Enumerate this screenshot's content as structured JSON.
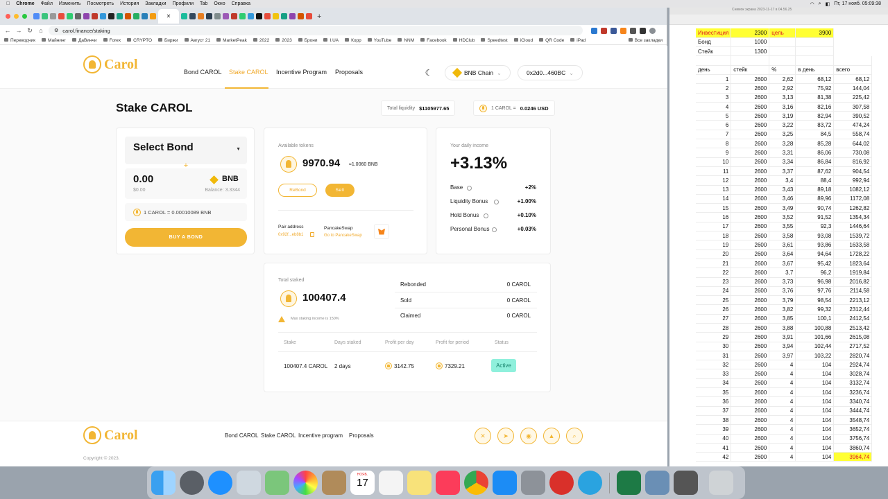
{
  "mac_menu": {
    "apple": "",
    "app": "Chrome",
    "items": [
      "Файл",
      "Изменить",
      "Посмотреть",
      "История",
      "Закладки",
      "Профили",
      "Tab",
      "Окно",
      "Справка"
    ],
    "clock": "Пт, 17 нояб. 05:09:38"
  },
  "browser": {
    "active_tab_icon": "✕",
    "url": "carol.finance/staking",
    "bookmarks": [
      "Переводчик",
      "Майнинг",
      "ДаВинчи",
      "Forex",
      "CRYPTO",
      "Биржи",
      "Август 21",
      "MarketPeak",
      "2022",
      "2023",
      "Брони",
      "I.UA",
      "Корр",
      "YouTube",
      "NNM",
      "Facebook",
      "HDClub",
      "Speedtest",
      "iCloud",
      "QR Code",
      "iPad",
      "Все закладки"
    ]
  },
  "site": {
    "logo": "Carol",
    "nav": [
      "Bond CAROL",
      "Stake CAROL",
      "Incentive Program",
      "Proposals"
    ],
    "chain": "BNB Chain",
    "wallet": "0x2d0...460BC",
    "page_title": "Stake CAROL",
    "total_liquidity_label": "Total liquidity",
    "total_liquidity": "$1105977.65",
    "price_label": "1 CAROL =",
    "price": "0.0246 USD",
    "bond": {
      "select": "Select Bond",
      "plus": "+",
      "amount": "0.00",
      "usd": "$0.00",
      "token": "BNB",
      "balance": "Balance: 3.3344",
      "rate": "1 CAROL = 0.00010089 BNB",
      "buy": "BUY A BOND"
    },
    "available": {
      "label": "Available tokens",
      "amount": "9970.94",
      "bnb": "≈1.0060 BNB",
      "rebond": "ReBond",
      "sell": "Sell",
      "pair_label": "Pair address",
      "pair_value": "0x92f...eb8b1",
      "pancake_label": "PancakeSwap",
      "pancake_link": "Go to PancakeSwap"
    },
    "income": {
      "label": "Your daily income",
      "value": "+3.13%",
      "rows": [
        {
          "k": "Base",
          "v": "+2%"
        },
        {
          "k": "Liquidity Bonus",
          "v": "+1.00%"
        },
        {
          "k": "Hold Bonus",
          "v": "+0.10%"
        },
        {
          "k": "Personal Bonus",
          "v": "+0.03%"
        }
      ]
    },
    "staked": {
      "label": "Total staked",
      "amount": "100407.4",
      "warn": "Max staking income is 150%",
      "side": [
        {
          "k": "Rebonded",
          "v": "0 CAROL"
        },
        {
          "k": "Sold",
          "v": "0 CAROL"
        },
        {
          "k": "Claimed",
          "v": "0 CAROL"
        }
      ],
      "headers": [
        "Stake",
        "Days staked",
        "Profit per day",
        "Profit for period",
        "Status"
      ],
      "row": {
        "stake": "100407.4 CAROL",
        "days": "2 days",
        "ppd": "3142.75",
        "pfp": "7329.21",
        "status": "Active"
      }
    },
    "footer": {
      "links": [
        "Bond CAROL",
        "Stake CAROL",
        "Incentive program",
        "Proposals"
      ],
      "copyright": "Copyright © 2023."
    }
  },
  "sheet": {
    "title": "Снимок экрана 2023-11-17 в 04.56.25",
    "top": [
      {
        "a": "Инвестиция",
        "b": "2300",
        "c": "цель",
        "d": "3900"
      },
      {
        "a": "Бонд",
        "b": "1000",
        "c": "",
        "d": ""
      },
      {
        "a": "Стейк",
        "b": "1300",
        "c": "",
        "d": ""
      }
    ],
    "headers": [
      "день",
      "стейк",
      "%",
      "в день",
      "всего"
    ],
    "rows": [
      [
        "1",
        "2600",
        "2,62",
        "68,12",
        "68,12"
      ],
      [
        "2",
        "2600",
        "2,92",
        "75,92",
        "144,04"
      ],
      [
        "3",
        "2600",
        "3,13",
        "81,38",
        "225,42"
      ],
      [
        "4",
        "2600",
        "3,16",
        "82,16",
        "307,58"
      ],
      [
        "5",
        "2600",
        "3,19",
        "82,94",
        "390,52"
      ],
      [
        "6",
        "2600",
        "3,22",
        "83,72",
        "474,24"
      ],
      [
        "7",
        "2600",
        "3,25",
        "84,5",
        "558,74"
      ],
      [
        "8",
        "2600",
        "3,28",
        "85,28",
        "644,02"
      ],
      [
        "9",
        "2600",
        "3,31",
        "86,06",
        "730,08"
      ],
      [
        "10",
        "2600",
        "3,34",
        "86,84",
        "816,92"
      ],
      [
        "11",
        "2600",
        "3,37",
        "87,62",
        "904,54"
      ],
      [
        "12",
        "2600",
        "3,4",
        "88,4",
        "992,94"
      ],
      [
        "13",
        "2600",
        "3,43",
        "89,18",
        "1082,12"
      ],
      [
        "14",
        "2600",
        "3,46",
        "89,96",
        "1172,08"
      ],
      [
        "15",
        "2600",
        "3,49",
        "90,74",
        "1262,82"
      ],
      [
        "16",
        "2600",
        "3,52",
        "91,52",
        "1354,34"
      ],
      [
        "17",
        "2600",
        "3,55",
        "92,3",
        "1446,64"
      ],
      [
        "18",
        "2600",
        "3,58",
        "93,08",
        "1539,72"
      ],
      [
        "19",
        "2600",
        "3,61",
        "93,86",
        "1633,58"
      ],
      [
        "20",
        "2600",
        "3,64",
        "94,64",
        "1728,22"
      ],
      [
        "21",
        "2600",
        "3,67",
        "95,42",
        "1823,64"
      ],
      [
        "22",
        "2600",
        "3,7",
        "96,2",
        "1919,84"
      ],
      [
        "23",
        "2600",
        "3,73",
        "96,98",
        "2016,82"
      ],
      [
        "24",
        "2600",
        "3,76",
        "97,76",
        "2114,58"
      ],
      [
        "25",
        "2600",
        "3,79",
        "98,54",
        "2213,12"
      ],
      [
        "26",
        "2600",
        "3,82",
        "99,32",
        "2312,44"
      ],
      [
        "27",
        "2600",
        "3,85",
        "100,1",
        "2412,54"
      ],
      [
        "28",
        "2600",
        "3,88",
        "100,88",
        "2513,42"
      ],
      [
        "29",
        "2600",
        "3,91",
        "101,66",
        "2615,08"
      ],
      [
        "30",
        "2600",
        "3,94",
        "102,44",
        "2717,52"
      ],
      [
        "31",
        "2600",
        "3,97",
        "103,22",
        "2820,74"
      ],
      [
        "32",
        "2600",
        "4",
        "104",
        "2924,74"
      ],
      [
        "33",
        "2600",
        "4",
        "104",
        "3028,74"
      ],
      [
        "34",
        "2600",
        "4",
        "104",
        "3132,74"
      ],
      [
        "35",
        "2600",
        "4",
        "104",
        "3236,74"
      ],
      [
        "36",
        "2600",
        "4",
        "104",
        "3340,74"
      ],
      [
        "37",
        "2600",
        "4",
        "104",
        "3444,74"
      ],
      [
        "38",
        "2600",
        "4",
        "104",
        "3548,74"
      ],
      [
        "39",
        "2600",
        "4",
        "104",
        "3652,74"
      ],
      [
        "40",
        "2600",
        "4",
        "104",
        "3756,74"
      ],
      [
        "41",
        "2600",
        "4",
        "104",
        "3860,74"
      ],
      [
        "42",
        "2600",
        "4",
        "104",
        "3964,74"
      ]
    ]
  },
  "dock": {
    "calendar_month": "НОЯБ.",
    "calendar_day": "17"
  },
  "colors": {
    "accent": "#f2b634",
    "accent_text": "#f0a92a",
    "active_badge": "#8ff0dc",
    "highlight": "#ffff33"
  }
}
